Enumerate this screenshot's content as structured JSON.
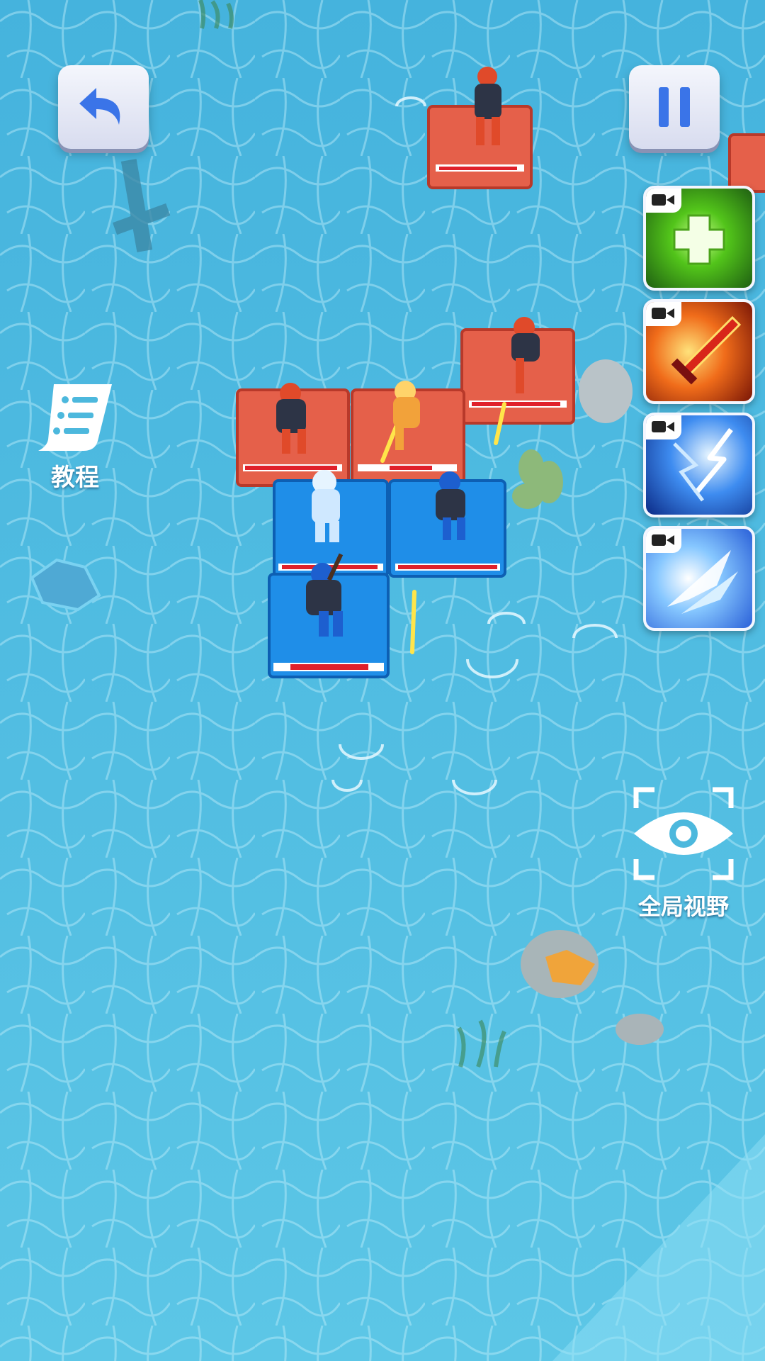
{
  "hud": {
    "back_icon": "undo-arrow-icon",
    "pause_icon": "pause-icon",
    "tutorial_label": "教程",
    "tutorial_icon": "scroll-list-icon",
    "global_view_label": "全局视野",
    "global_view_icon": "eye-frame-icon"
  },
  "skills": [
    {
      "icon": "heal-cross-icon",
      "badge_icon": "video-camera-icon"
    },
    {
      "icon": "flame-sword-icon",
      "badge_icon": "video-camera-icon"
    },
    {
      "icon": "lightning-icon",
      "badge_icon": "video-camera-icon"
    },
    {
      "icon": "ice-shard-icon",
      "badge_icon": "video-camera-icon"
    }
  ],
  "colors": {
    "water": "#4cb8dd",
    "enemy_tile": "#e5604a",
    "player_tile": "#1f8ee8",
    "health_bar": "#e0202a"
  }
}
